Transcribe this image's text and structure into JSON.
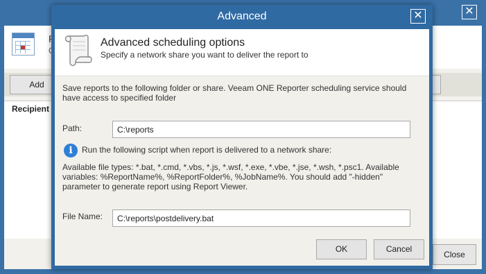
{
  "background_window": {
    "close_glyph": "✕",
    "header_line1": "R",
    "header_line2": "C",
    "add_label": "Add",
    "recipients_header": "Recipient",
    "close_label": "Close"
  },
  "dialog": {
    "title": "Advanced",
    "close_glyph": "✕",
    "heading": "Advanced scheduling options",
    "subheading": "Specify a network share you want to deliver the report to",
    "description": "Save reports to the following folder or share. Veeam ONE Reporter scheduling service should have access to specified folder",
    "path_label": "Path:",
    "path_value": "C:\\reports",
    "info_text": "Run the following script when report is delivered to a network share:",
    "available_text": "Available file types: *.bat, *.cmd, *.vbs, *.js, *.wsf, *.exe, *.vbe, *.jse, *.wsh, *.psc1. Available variables: %ReportName%, %ReportFolder%, %JobName%. You should add \"-hidden\" parameter to generate report using Report Viewer.",
    "file_name_label": "File Name:",
    "file_name_value": "C:\\reports\\postdelivery.bat",
    "ok_label": "OK",
    "cancel_label": "Cancel"
  },
  "icons": {
    "scroll": "scroll-icon",
    "info": "info-icon",
    "calendar": "calendar-icon"
  }
}
